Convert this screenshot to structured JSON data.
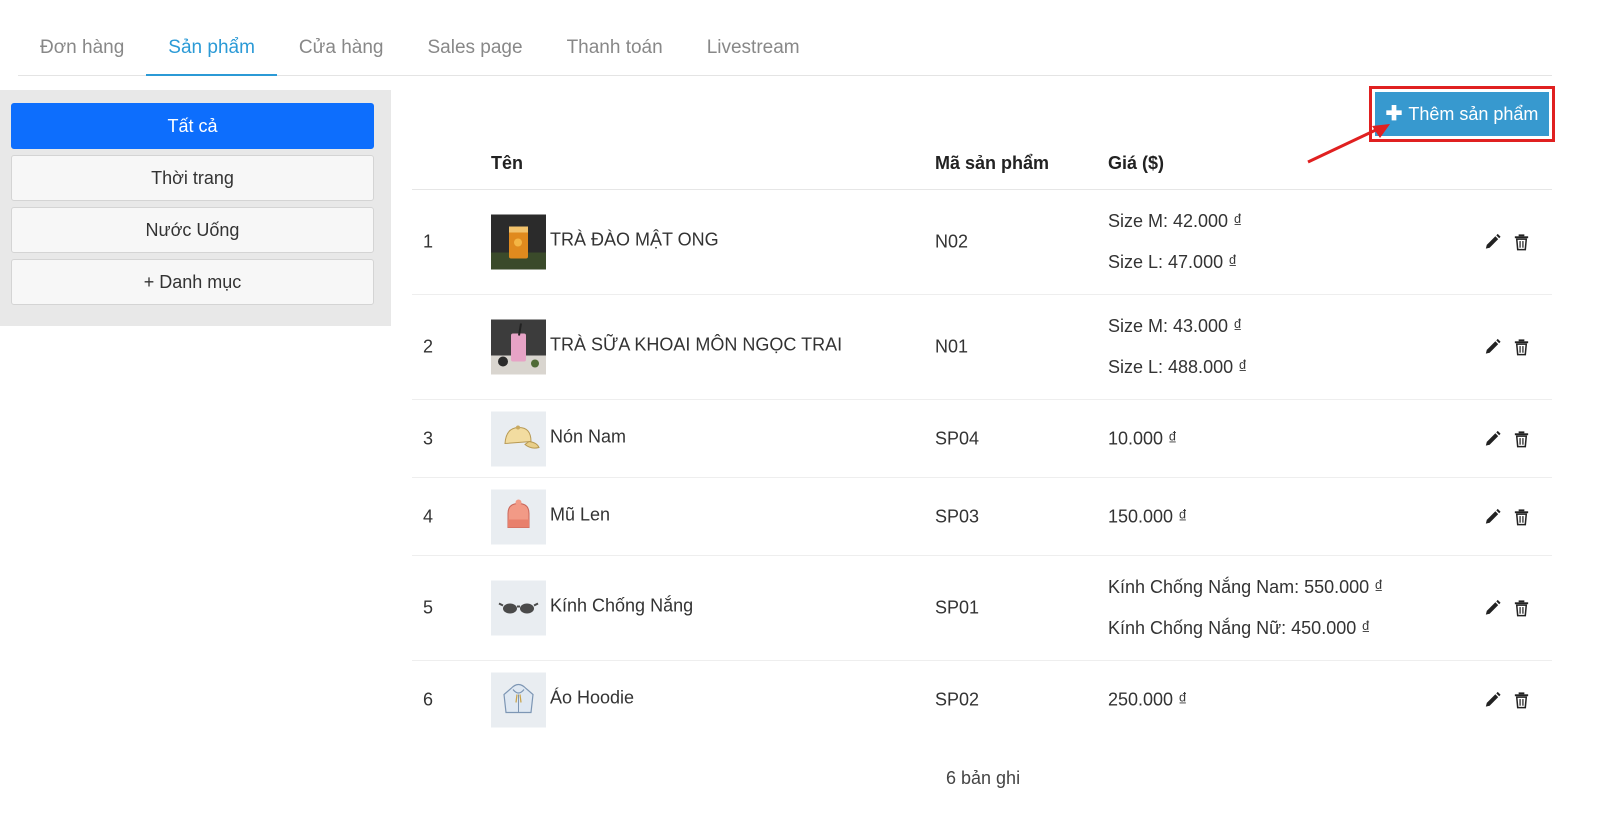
{
  "tabs": [
    {
      "label": "Đơn hàng"
    },
    {
      "label": "Sản phẩm"
    },
    {
      "label": "Cửa hàng"
    },
    {
      "label": "Sales page"
    },
    {
      "label": "Thanh toán"
    },
    {
      "label": "Livestream"
    }
  ],
  "active_tab": "Sản phẩm",
  "sidebar": {
    "categories": [
      {
        "label": "Tất cả"
      },
      {
        "label": "Thời trang"
      },
      {
        "label": "Nước Uống"
      },
      {
        "label": "+ Danh mục"
      }
    ]
  },
  "toolbar": {
    "add_label": "Thêm sản phẩm"
  },
  "table": {
    "headers": {
      "name": "Tên",
      "code": "Mã sản phẩm",
      "price": "Giá ($)"
    },
    "rows": [
      {
        "num": "1",
        "name": "TRÀ ĐÀO MẬT ONG",
        "code": "N02",
        "prices": [
          "Size M: 42.000 ₫",
          "Size L: 47.000 ₫"
        ],
        "thumb_icon": "peach-tea-photo"
      },
      {
        "num": "2",
        "name": "TRÀ SỮA KHOAI MÔN NGỌC TRAI",
        "code": "N01",
        "prices": [
          "Size M: 43.000 ₫",
          "Size L: 488.000 ₫"
        ],
        "thumb_icon": "taro-milk-tea-photo"
      },
      {
        "num": "3",
        "name": "Nón Nam",
        "code": "SP04",
        "prices": [
          "10.000 ₫"
        ],
        "thumb_icon": "cap-icon"
      },
      {
        "num": "4",
        "name": "Mũ Len",
        "code": "SP03",
        "prices": [
          "150.000 ₫"
        ],
        "thumb_icon": "beanie-icon"
      },
      {
        "num": "5",
        "name": "Kính Chống Nắng",
        "code": "SP01",
        "prices": [
          "Kính Chống Nắng Nam: 550.000 ₫",
          "Kính Chống Nắng Nữ: 450.000 ₫"
        ],
        "thumb_icon": "sunglasses-icon"
      },
      {
        "num": "6",
        "name": "Áo Hoodie",
        "code": "SP02",
        "prices": [
          "250.000 ₫"
        ],
        "thumb_icon": "hoodie-icon"
      }
    ]
  },
  "footer": {
    "count": "6 bản ghi"
  },
  "colors": {
    "tab_active": "#2b9ad6",
    "category_active": "#0d6efd",
    "add_button": "#3799cf",
    "highlight": "#e02020"
  }
}
